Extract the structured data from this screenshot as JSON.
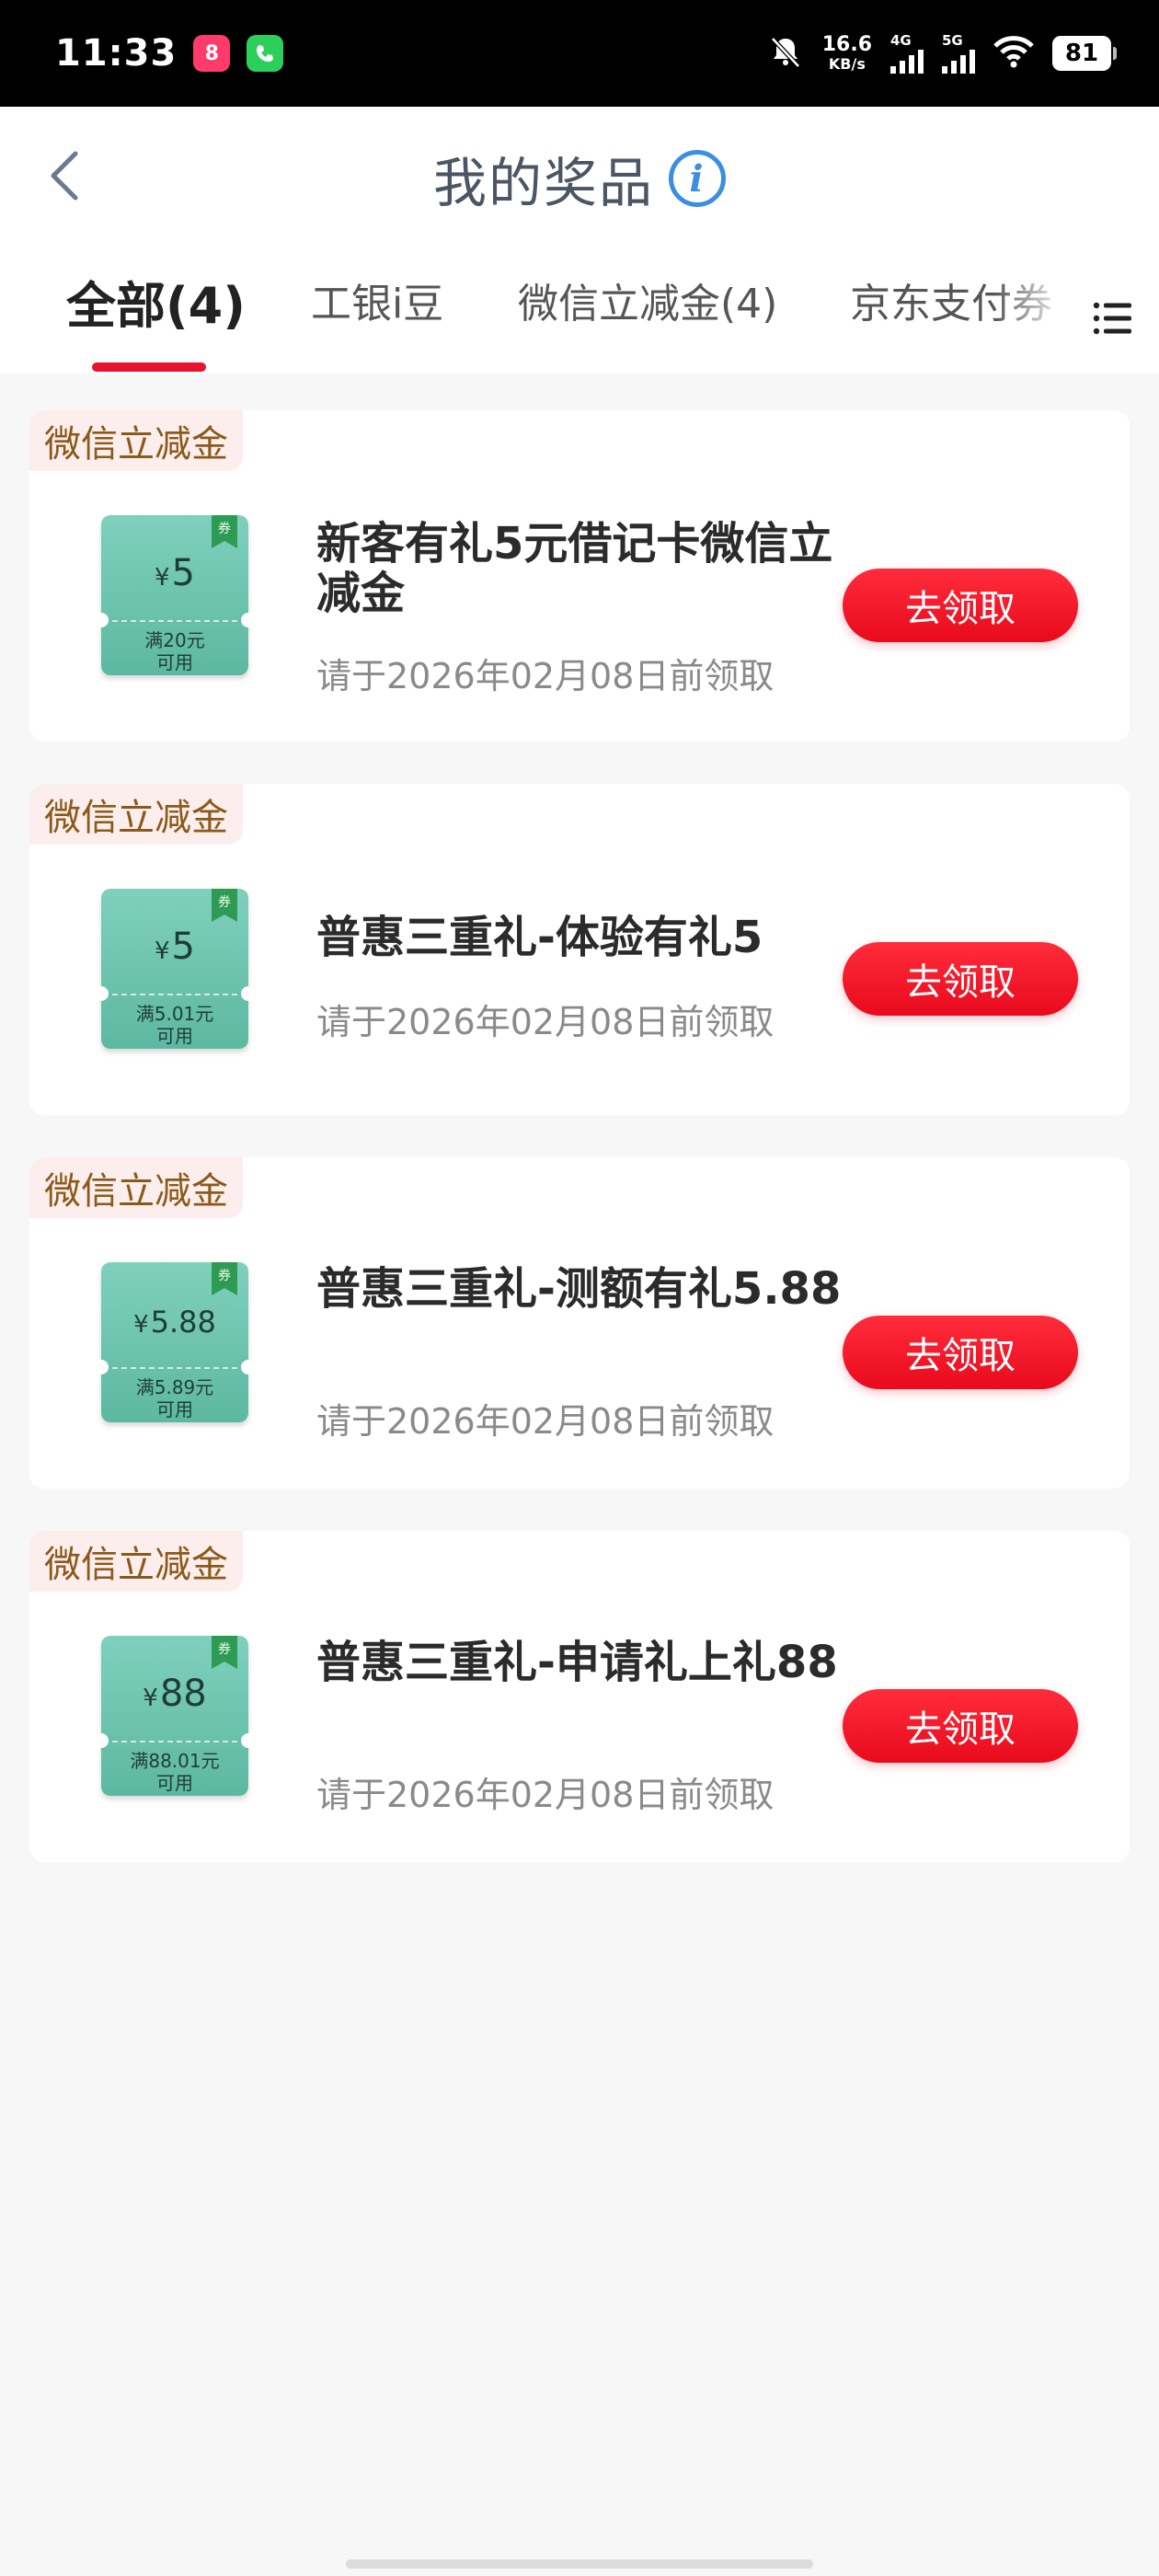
{
  "status_bar": {
    "time": "11:33",
    "speed_value": "16.6",
    "speed_unit": "KB/s",
    "net1": "4G",
    "net2": "5G",
    "battery": "81"
  },
  "header": {
    "title": "我的奖品"
  },
  "tabs": [
    {
      "label": "全部(4)",
      "active": true
    },
    {
      "label": "工银i豆"
    },
    {
      "label": "微信立减金(4)"
    },
    {
      "label": "京东支付券"
    }
  ],
  "prizes": [
    {
      "tag": "微信立减金",
      "coupon_amount": "5",
      "coupon_yen": "¥",
      "coupon_cond_1": "满20元",
      "coupon_cond_2": "可用",
      "coupon_ribbon": "券",
      "title": "新客有礼5元借记卡微信立减金",
      "deadline": "请于2026年02月08日前领取",
      "button": "去领取"
    },
    {
      "tag": "微信立减金",
      "coupon_amount": "5",
      "coupon_yen": "¥",
      "coupon_cond_1": "满5.01元",
      "coupon_cond_2": "可用",
      "coupon_ribbon": "券",
      "title": "普惠三重礼-体验有礼5",
      "deadline": "请于2026年02月08日前领取",
      "button": "去领取"
    },
    {
      "tag": "微信立减金",
      "coupon_amount": "5.88",
      "coupon_yen": "¥",
      "coupon_cond_1": "满5.89元",
      "coupon_cond_2": "可用",
      "coupon_ribbon": "券",
      "title": "普惠三重礼-测额有礼5.88",
      "deadline": "请于2026年02月08日前领取",
      "button": "去领取"
    },
    {
      "tag": "微信立减金",
      "coupon_amount": "88",
      "coupon_yen": "¥",
      "coupon_cond_1": "满88.01元",
      "coupon_cond_2": "可用",
      "coupon_ribbon": "券",
      "title": "普惠三重礼-申请礼上礼88",
      "deadline": "请于2026年02月08日前领取",
      "button": "去领取"
    }
  ],
  "colors": {
    "accent_red": "#e5132b",
    "coupon_green": "#5db8a1",
    "tag_text": "#8a5a1a",
    "info_blue": "#3b8fe0"
  }
}
